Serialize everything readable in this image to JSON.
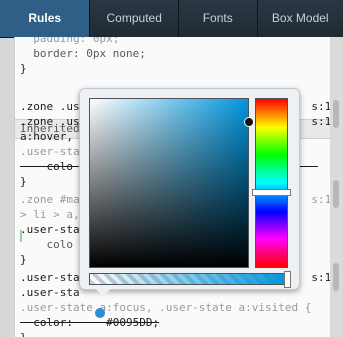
{
  "tabs": [
    {
      "label": "Rules",
      "active": true
    },
    {
      "label": "Computed",
      "active": false
    },
    {
      "label": "Fonts",
      "active": false
    },
    {
      "label": "Box Model",
      "active": false
    }
  ],
  "code": {
    "lines": [
      {
        "text": "  padding: 0px;",
        "style": "dim"
      },
      {
        "text": "  border: 0px none;",
        "style": "prop"
      },
      {
        "text": "}",
        "style": "sel"
      },
      {
        "text": "Inherited from a#create-profile",
        "style": "header"
      },
      {
        "text": ".zone .us                                   s:1",
        "style": "sel"
      },
      {
        "text": ".zone .us                                   s:1",
        "style": "sel"
      },
      {
        "text": "a:hover,                                      ",
        "style": "sel"
      },
      {
        "text": ".user-sta                                     ",
        "style": "dim"
      },
      {
        "text": "    colo                                     ",
        "style": "strike"
      },
      {
        "text": "}",
        "style": "sel"
      },
      {
        "text": ".zone #ma                                   s:1",
        "style": "dim"
      },
      {
        "text": "> li > a,                                     ",
        "style": "dim"
      },
      {
        "text": ".user-sta                                     ",
        "style": "sel"
      },
      {
        "text": "    colo                                       ",
        "style": "prop"
      },
      {
        "text": "}",
        "style": "sel"
      },
      {
        "text": ".user-sta                                   s:1",
        "style": "sel"
      },
      {
        "text": ".user-sta                                     ",
        "style": "sel"
      },
      {
        "text": ".user-state a:focus, .user-state a:visited {",
        "style": "dim"
      },
      {
        "text": "  color:     #0095DD;",
        "style": "strike"
      },
      {
        "text": "}",
        "style": "sel"
      }
    ]
  },
  "picker": {
    "color": "#0095DD",
    "alpha_percent": 100,
    "hue_marker_fraction": 0.55
  },
  "colors": {
    "tab_active_bg": "#2f5e86",
    "tab_bg": "#233039",
    "swatch": "#0095DD"
  }
}
